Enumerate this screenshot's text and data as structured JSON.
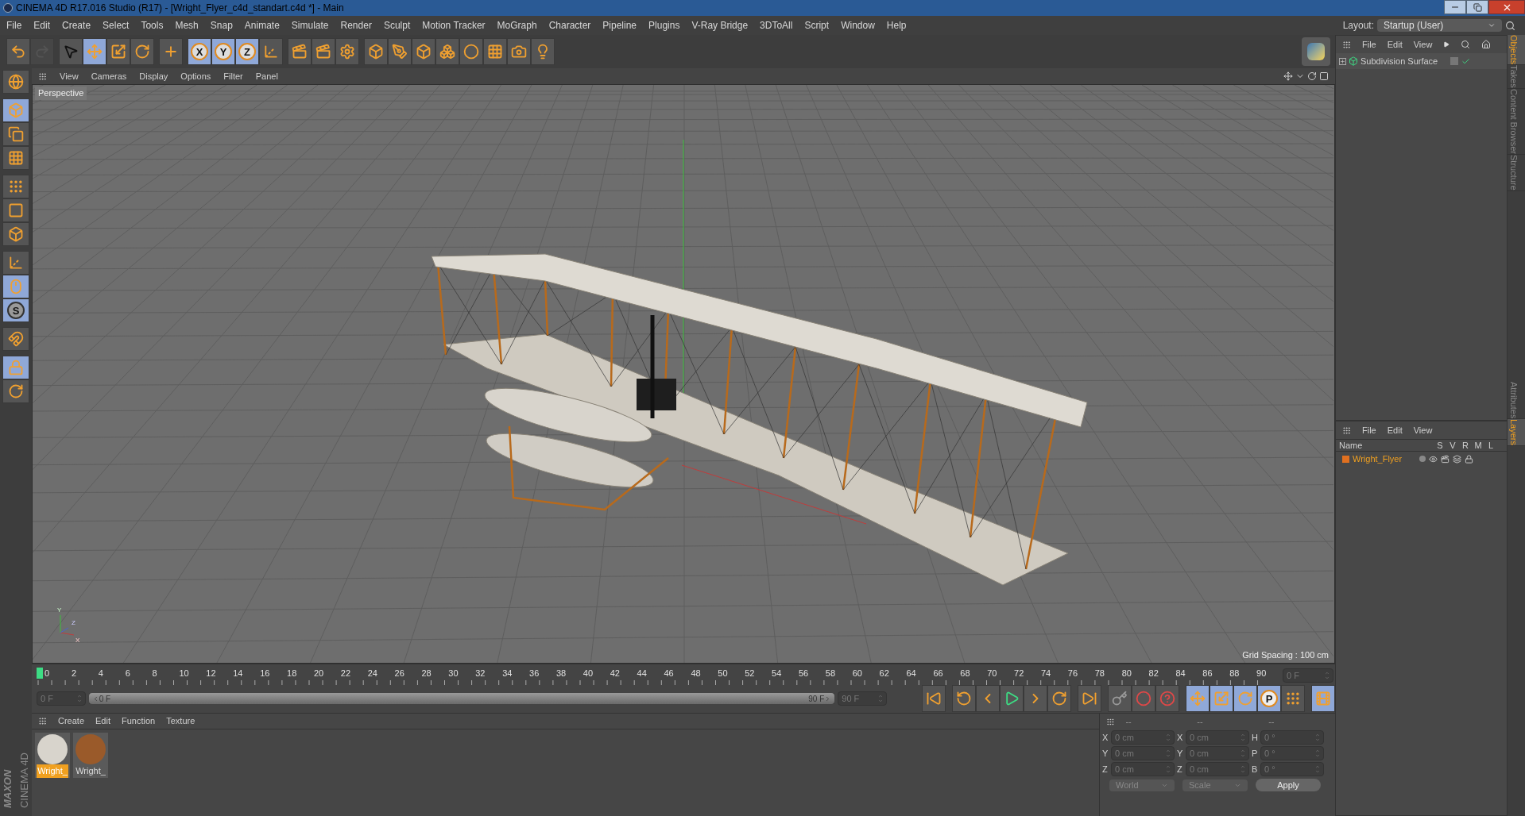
{
  "window": {
    "title": "CINEMA 4D R17.016 Studio (R17) - [Wright_Flyer_c4d_standart.c4d *] - Main"
  },
  "menu": [
    "File",
    "Edit",
    "Create",
    "Select",
    "Tools",
    "Mesh",
    "Snap",
    "Animate",
    "Simulate",
    "Render",
    "Sculpt",
    "Motion Tracker",
    "MoGraph",
    "Character",
    "Pipeline",
    "Plugins",
    "V-Ray Bridge",
    "3DToAll",
    "Script",
    "Window",
    "Help"
  ],
  "layout": {
    "label": "Layout:",
    "value": "Startup (User)"
  },
  "toolbar": [
    [
      {
        "kind": "undo",
        "selected": false,
        "disabled": false
      },
      {
        "kind": "redo",
        "selected": false,
        "disabled": true
      }
    ],
    [
      {
        "kind": "select",
        "selected": false,
        "disabled": false
      },
      {
        "kind": "move",
        "selected": true,
        "disabled": false
      },
      {
        "kind": "scale",
        "selected": false,
        "disabled": false
      },
      {
        "kind": "rotate",
        "selected": false,
        "disabled": false
      }
    ],
    [
      {
        "kind": "transform",
        "selected": false,
        "disabled": false
      }
    ],
    [
      {
        "kind": "axis-lock",
        "label": "X",
        "selected": true,
        "disabled": false
      },
      {
        "kind": "axis-lock",
        "label": "Y",
        "selected": true,
        "disabled": false
      },
      {
        "kind": "axis-lock",
        "label": "Z",
        "selected": true,
        "disabled": false
      },
      {
        "kind": "coords",
        "selected": false,
        "disabled": false
      }
    ],
    [
      {
        "kind": "render-view",
        "selected": false,
        "disabled": false
      },
      {
        "kind": "render-picture",
        "selected": false,
        "disabled": false
      },
      {
        "kind": "render-settings",
        "selected": false,
        "disabled": false
      }
    ],
    [
      {
        "kind": "cube",
        "selected": false,
        "disabled": false
      },
      {
        "kind": "pen",
        "selected": false,
        "disabled": false
      },
      {
        "kind": "subdivision",
        "selected": false,
        "disabled": false
      },
      {
        "kind": "cloner",
        "selected": false,
        "disabled": false
      },
      {
        "kind": "deformer",
        "selected": false,
        "disabled": false
      },
      {
        "kind": "floor",
        "selected": false,
        "disabled": false
      },
      {
        "kind": "camera",
        "selected": false,
        "disabled": false
      },
      {
        "kind": "light",
        "selected": false,
        "disabled": false
      }
    ]
  ],
  "left_tools": [
    [
      {
        "kind": "make-editable",
        "selected": false
      }
    ],
    [
      {
        "kind": "model",
        "selected": true
      },
      {
        "kind": "texture",
        "selected": false
      },
      {
        "kind": "workplane",
        "selected": false
      }
    ],
    [
      {
        "kind": "points",
        "selected": false
      },
      {
        "kind": "edges",
        "selected": false
      },
      {
        "kind": "polygons",
        "selected": false
      }
    ],
    [
      {
        "kind": "axis",
        "selected": false
      },
      {
        "kind": "tweak",
        "selected": true
      },
      {
        "kind": "snap",
        "label": "S",
        "selected": true
      }
    ],
    [
      {
        "kind": "magnet",
        "selected": false
      }
    ],
    [
      {
        "kind": "grid-lock",
        "selected": true
      },
      {
        "kind": "grid-sync",
        "selected": false
      }
    ]
  ],
  "viewport": {
    "menu": [
      "View",
      "Cameras",
      "Display",
      "Options",
      "Filter",
      "Panel"
    ],
    "camera": "Perspective",
    "grid_spacing": "Grid Spacing : 100 cm",
    "axis_labels": [
      "Y",
      "X",
      "Z"
    ]
  },
  "timeline": {
    "ruler": [
      "0",
      "2",
      "4",
      "6",
      "8",
      "10",
      "12",
      "14",
      "16",
      "18",
      "20",
      "22",
      "24",
      "26",
      "28",
      "30",
      "32",
      "34",
      "36",
      "38",
      "40",
      "42",
      "44",
      "46",
      "48",
      "50",
      "52",
      "54",
      "56",
      "58",
      "60",
      "62",
      "64",
      "66",
      "68",
      "70",
      "72",
      "74",
      "76",
      "78",
      "80",
      "82",
      "84",
      "86",
      "88",
      "90"
    ],
    "current": "0 F",
    "start": "0 F",
    "range_start": "0 F",
    "range_end": "90 F",
    "range_slider": {
      "level": 1
    },
    "end": "90 F",
    "controls": [
      [
        {
          "kind": "first",
          "selected": false
        }
      ],
      [
        {
          "kind": "prev-key",
          "selected": false
        },
        {
          "kind": "prev-frame",
          "selected": false
        },
        {
          "kind": "play",
          "selected": false
        },
        {
          "kind": "next-frame",
          "selected": false
        },
        {
          "kind": "next-key",
          "selected": false
        }
      ],
      [
        {
          "kind": "last",
          "selected": false
        }
      ],
      [
        {
          "kind": "key",
          "selected": false
        },
        {
          "kind": "record",
          "selected": false
        },
        {
          "kind": "help",
          "selected": false
        }
      ],
      [
        {
          "kind": "move",
          "selected": true
        },
        {
          "kind": "scale",
          "selected": true
        },
        {
          "kind": "rotate",
          "selected": true
        },
        {
          "kind": "param",
          "label": "P",
          "selected": true
        },
        {
          "kind": "points",
          "selected": false
        }
      ],
      [
        {
          "kind": "film",
          "selected": true
        }
      ]
    ]
  },
  "materials": {
    "menu": [
      "Create",
      "Edit",
      "Function",
      "Texture"
    ],
    "items": [
      {
        "name": "Wright_",
        "color": "#d8d4cc",
        "selected": true
      },
      {
        "name": "Wright_",
        "color": "#9a5a2a",
        "selected": false
      }
    ]
  },
  "coordinates": {
    "headers": [
      "--",
      "--",
      "--"
    ],
    "rows": [
      {
        "axis": "X",
        "position": "0 cm",
        "size_axis": "X",
        "size": "0 cm",
        "rot_axis": "H",
        "rotation": "0 °"
      },
      {
        "axis": "Y",
        "position": "0 cm",
        "size_axis": "Y",
        "size": "0 cm",
        "rot_axis": "P",
        "rotation": "0 °"
      },
      {
        "axis": "Z",
        "position": "0 cm",
        "size_axis": "Z",
        "size": "0 cm",
        "rot_axis": "B",
        "rotation": "0 °"
      }
    ],
    "system": "World",
    "mode": "Scale",
    "apply": "Apply"
  },
  "objects": {
    "menu": [
      "File",
      "Edit",
      "View"
    ],
    "items": [
      {
        "name": "Subdivision Surface",
        "expanded": false,
        "enabled": true
      }
    ]
  },
  "layers": {
    "menu": [
      "File",
      "Edit",
      "View"
    ],
    "columns": [
      "Name",
      "S",
      "V",
      "R",
      "M",
      "L"
    ],
    "items": [
      {
        "name": "Wright_Flyer",
        "color": "#e07020"
      }
    ]
  },
  "side_tabs_top": [
    {
      "label": "Objects",
      "selected": true
    },
    {
      "label": "Takes",
      "selected": false
    },
    {
      "label": "Content Browser",
      "selected": false
    },
    {
      "label": "Structure",
      "selected": false
    }
  ],
  "side_tabs_bottom": [
    {
      "label": "Attributes",
      "selected": false
    },
    {
      "label": "Layers",
      "selected": true
    }
  ],
  "logo": {
    "brand": "MAXON",
    "product": "CINEMA 4D"
  }
}
